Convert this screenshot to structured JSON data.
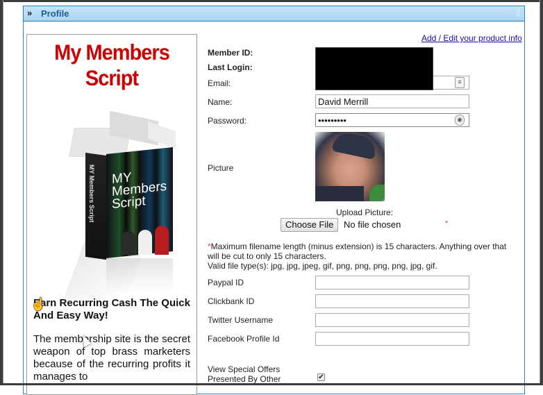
{
  "panel": {
    "title": "Profile",
    "header_icon": "double-chevron-right-icon",
    "grip_icon": "grip-icon",
    "accent_color": "#2d7fb5"
  },
  "promo": {
    "logo_line1": "My Members",
    "logo_line2": "Script",
    "box_title_line1": "MY",
    "box_title_line2": "Members",
    "box_title_line3": "Script",
    "box_side_text": "MY Members Script",
    "headline": "Earn Recurring Cash The Quick And Easy Way!",
    "body": "The membership site is the secret weapon of top brass marketers because of the recurring profits it manages to"
  },
  "form": {
    "edit_link": "Add / Edit your product info",
    "member_id_label": "Member ID:",
    "last_login_label": "Last Login:",
    "email_label": "Email:",
    "email_value": "",
    "name_label": "Name:",
    "name_value": "David Merrill",
    "password_label": "Password:",
    "password_value": "•••••••••",
    "picture_label": "Picture",
    "upload_label": "Upload Picture:",
    "choose_file_label": "Choose File",
    "no_file_text": "No file chosen",
    "required_mark": "*",
    "note_star": "*",
    "note_line1": "Maximum filename length (minus extension) is 15 characters. Anything over that will be cut to only 15 characters.",
    "note_line2": "Valid file type(s): jpg, jpg, jpeg, gif, png, png, png, png, jpg, gif.",
    "paypal_label": "Paypal ID",
    "paypal_value": "",
    "clickbank_label": "Clickbank ID",
    "clickbank_value": "",
    "twitter_label": "Twitter Username",
    "twitter_value": "",
    "facebook_label": "Facebook Profile Id",
    "facebook_value": "",
    "special_offers_label_line1": "View Special Offers",
    "special_offers_label_line2": "Presented By Other",
    "special_offers_checked": true,
    "checkmark": "✔"
  }
}
